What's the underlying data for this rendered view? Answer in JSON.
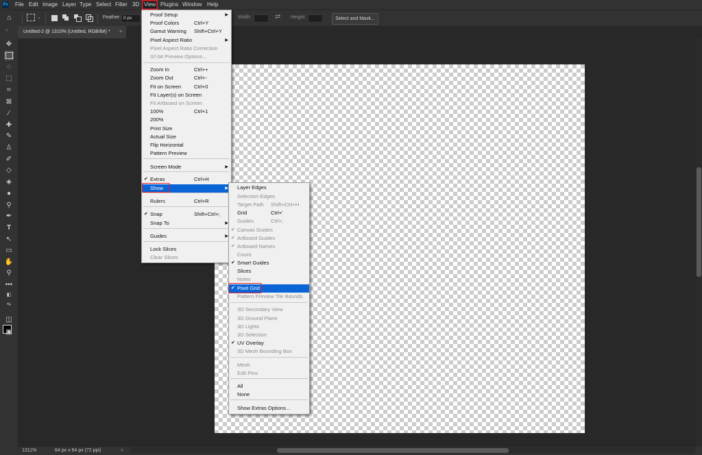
{
  "app": {
    "logo": "Ps"
  },
  "menubar": [
    "File",
    "Edit",
    "Image",
    "Layer",
    "Type",
    "Select",
    "Filter",
    "3D",
    "View",
    "Plugins",
    "Window",
    "Help"
  ],
  "options_bar": {
    "feather_label": "Feather:",
    "feather_value": "0 px",
    "width_label": "Width:",
    "height_label": "Height:",
    "select_mask_label": "Select and Mask..."
  },
  "document_tab": {
    "title": "Untitled-2 @ 1310% (Untitled, RGB/8#) *",
    "close": "×"
  },
  "status": {
    "zoom": "1311%",
    "doc_info": "64 px x 64 px (72 ppi)",
    "arrow": ">"
  },
  "view_menu": {
    "items": [
      {
        "label": "Proof Setup",
        "submenu": true
      },
      {
        "label": "Proof Colors",
        "shortcut": "Ctrl+Y"
      },
      {
        "label": "Gamut Warning",
        "shortcut": "Shift+Ctrl+Y"
      },
      {
        "label": "Pixel Aspect Ratio",
        "submenu": true
      },
      {
        "label": "Pixel Aspect Ratio Correction",
        "disabled": true
      },
      {
        "label": "32-bit Preview Options...",
        "disabled": true
      },
      {
        "sep": true
      },
      {
        "label": "Zoom In",
        "shortcut": "Ctrl++"
      },
      {
        "label": "Zoom Out",
        "shortcut": "Ctrl+-"
      },
      {
        "label": "Fit on Screen",
        "shortcut": "Ctrl+0"
      },
      {
        "label": "Fit Layer(s) on Screen"
      },
      {
        "label": "Fit Artboard on Screen",
        "disabled": true
      },
      {
        "label": "100%",
        "shortcut": "Ctrl+1"
      },
      {
        "label": "200%"
      },
      {
        "label": "Print Size"
      },
      {
        "label": "Actual Size"
      },
      {
        "label": "Flip Horizontal"
      },
      {
        "label": "Pattern Preview"
      },
      {
        "sep": true
      },
      {
        "label": "Screen Mode",
        "submenu": true
      },
      {
        "sep": true
      },
      {
        "label": "Extras",
        "shortcut": "Ctrl+H",
        "checked": true
      },
      {
        "label": "Show",
        "submenu": true,
        "highlighted": true
      },
      {
        "sep": true
      },
      {
        "label": "Rulers",
        "shortcut": "Ctrl+R"
      },
      {
        "sep": true
      },
      {
        "label": "Snap",
        "shortcut": "Shift+Ctrl+;",
        "checked": true
      },
      {
        "label": "Snap To",
        "submenu": true
      },
      {
        "sep": true
      },
      {
        "label": "Guides",
        "submenu": true
      },
      {
        "sep": true
      },
      {
        "label": "Lock Slices"
      },
      {
        "label": "Clear Slices",
        "disabled": true
      }
    ]
  },
  "show_menu": {
    "items": [
      {
        "label": "Layer Edges"
      },
      {
        "label": "Selection Edges",
        "disabled": true
      },
      {
        "label": "Target Path",
        "shortcut": "Shift+Ctrl+H",
        "disabled": true
      },
      {
        "label": "Grid",
        "shortcut": "Ctrl+'"
      },
      {
        "label": "Guides",
        "shortcut": "Ctrl+;",
        "disabled": true
      },
      {
        "label": "Canvas Guides",
        "checked": true,
        "disabled": true
      },
      {
        "label": "Artboard Guides",
        "checked": true,
        "disabled": true
      },
      {
        "label": "Artboard Names",
        "checked": true,
        "disabled": true
      },
      {
        "label": "Count",
        "disabled": true
      },
      {
        "label": "Smart Guides",
        "checked": true
      },
      {
        "label": "Slices"
      },
      {
        "label": "Notes",
        "disabled": true
      },
      {
        "label": "Pixel Grid",
        "checked": true,
        "highlighted": true
      },
      {
        "label": "Pattern Preview Tile Bounds",
        "disabled": true
      },
      {
        "sep": true
      },
      {
        "label": "3D Secondary View",
        "disabled": true
      },
      {
        "label": "3D Ground Plane",
        "disabled": true
      },
      {
        "label": "3D Lights",
        "disabled": true
      },
      {
        "label": "3D Selection",
        "disabled": true
      },
      {
        "label": "UV Overlay",
        "checked": true
      },
      {
        "label": "3D Mesh Bounding Box",
        "disabled": true
      },
      {
        "sep": true
      },
      {
        "label": "Mesh",
        "disabled": true
      },
      {
        "label": "Edit Pins",
        "disabled": true
      },
      {
        "sep": true
      },
      {
        "label": "All"
      },
      {
        "label": "None"
      },
      {
        "sep": true
      },
      {
        "label": "Show Extras Options..."
      }
    ]
  },
  "colors": {
    "highlight": "#0a64d6",
    "annotation": "#e4202b"
  }
}
